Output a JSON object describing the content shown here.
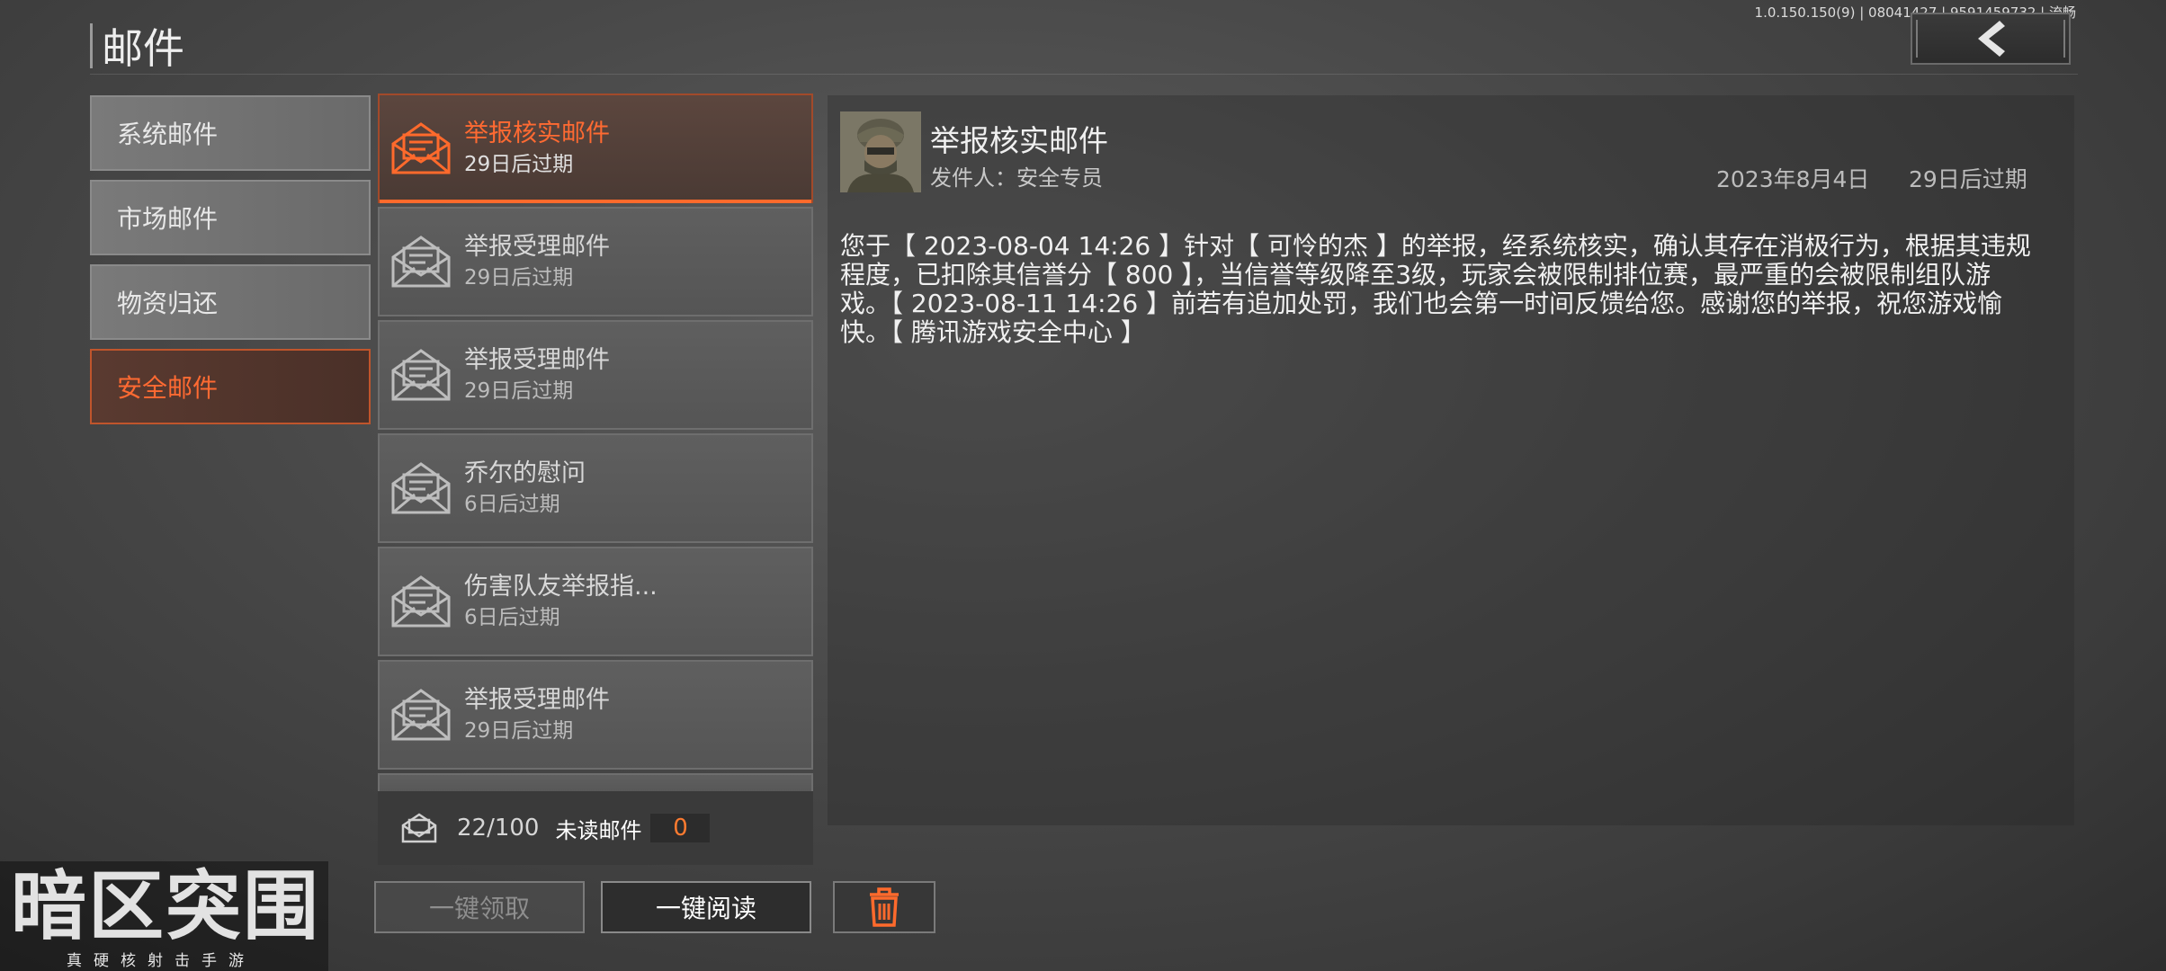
{
  "version": "1.0.150.150(9) | 08041427 | 9591459732 | 流畅",
  "page_title": "邮件",
  "categories": [
    {
      "label": "系统邮件"
    },
    {
      "label": "市场邮件"
    },
    {
      "label": "物资归还"
    },
    {
      "label": "安全邮件"
    }
  ],
  "mails": [
    {
      "subject": "举报核实邮件",
      "expire": "29日后过期"
    },
    {
      "subject": "举报受理邮件",
      "expire": "29日后过期"
    },
    {
      "subject": "举报受理邮件",
      "expire": "29日后过期"
    },
    {
      "subject": "乔尔的慰问",
      "expire": "6日后过期"
    },
    {
      "subject": "伤害队友举报指...",
      "expire": "6日后过期"
    },
    {
      "subject": "举报受理邮件",
      "expire": "29日后过期"
    }
  ],
  "footer": {
    "count": "22/100",
    "unread_label": "未读邮件",
    "unread_value": "0"
  },
  "buttons": {
    "claim_all": "一键领取",
    "read_all": "一键阅读"
  },
  "detail": {
    "subject": "举报核实邮件",
    "sender": "发件人：安全专员",
    "date": "2023年8月4日",
    "expire": "29日后过期",
    "body": "您于【 2023-08-04 14:26 】针对【 可怜的杰 】的举报，经系统核实，确认其存在消极行为，根据其违规程度，已扣除其信誉分【 800 】，当信誉等级降至3级，玩家会被限制排位赛，最严重的会被限制组队游戏。【 2023-08-11 14:26 】前若有追加处罚，我们也会第一时间反馈给您。感谢您的举报，祝您游戏愉快。【 腾讯游戏安全中心 】"
  },
  "brand": {
    "logo": "暗区突围",
    "tagline": "真硬核射击手游"
  },
  "colors": {
    "accent": "#ff6a2c",
    "active_text": "#ff6a32"
  },
  "icons": {
    "back": "chevron-left-icon",
    "mail": "envelope-icon",
    "delete": "trash-icon",
    "counter": "mail-stack-icon"
  }
}
